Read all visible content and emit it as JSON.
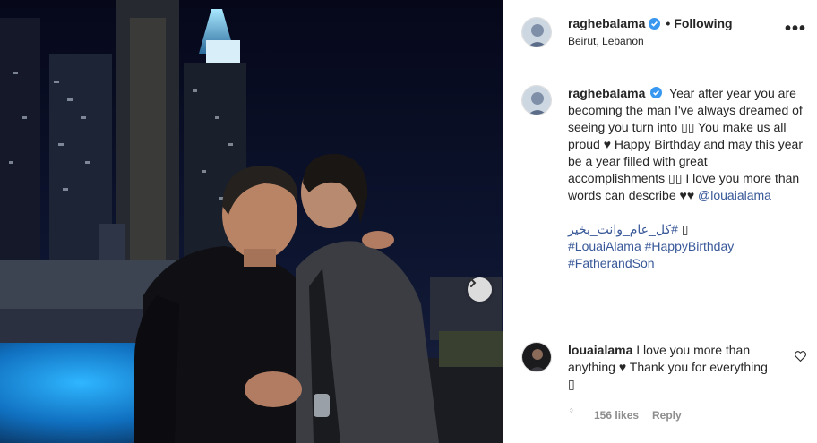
{
  "post": {
    "username": "raghebalama",
    "follow_status": "Following",
    "separator": "•",
    "location": "Beirut, Lebanon",
    "more_label": "•••"
  },
  "caption": {
    "username": "raghebalama",
    "text": "Year after year you are becoming the man I've always dreamed of seeing you turn into ▯▯ You make us all proud ♥ Happy Birthday and may this year be a year filled with great accomplishments ▯▯ I love you more than words can describe ♥♥",
    "mention": "@louaialama",
    "arabic_tag": "#كل_عام_وانت_بخير",
    "arabic_suffix": "▯",
    "tag_louai": "#LouaiAlama",
    "tag_birthday": "#HappyBirthday",
    "tag_father": "#FatherandSon"
  },
  "comment": {
    "username": "louaialama",
    "text": "I love you more than anything ♥ Thank you for everything ▯",
    "likes": "156 likes",
    "reply_label": "Reply",
    "tick": "ᵓ"
  },
  "icons": {
    "verified": "verified-badge-icon",
    "heart": "heart-outline-icon",
    "next": "chevron-right-icon",
    "more": "more-options-icon"
  },
  "colors": {
    "verified_blue": "#3897f0",
    "link_blue": "#385898",
    "text": "#262626",
    "muted": "#8e8e8e",
    "border": "#efefef"
  }
}
